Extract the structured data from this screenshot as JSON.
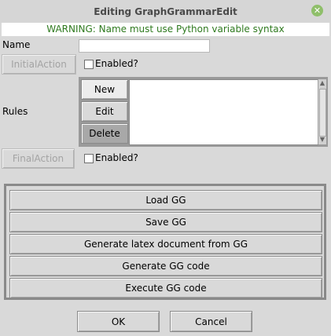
{
  "window": {
    "title": "Editing GraphGrammarEdit",
    "close_icon": "close-icon"
  },
  "warning": "WARNING: Name must use Python variable syntax",
  "name": {
    "label": "Name",
    "value": ""
  },
  "initial_action": {
    "button_label": "InitialAction",
    "checkbox_label": "Enabled?",
    "checked": false
  },
  "rules": {
    "label": "Rules",
    "buttons": {
      "new": "New",
      "edit": "Edit",
      "delete": "Delete"
    },
    "items": []
  },
  "final_action": {
    "button_label": "FinalAction",
    "checkbox_label": "Enabled?",
    "checked": false
  },
  "actions": [
    "Load GG",
    "Save GG",
    "Generate latex document from GG",
    "Generate GG code",
    "Execute GG code"
  ],
  "dialog": {
    "ok": "OK",
    "cancel": "Cancel"
  },
  "colors": {
    "warning_text": "#2f7a1f",
    "background": "#d9d9d9"
  }
}
